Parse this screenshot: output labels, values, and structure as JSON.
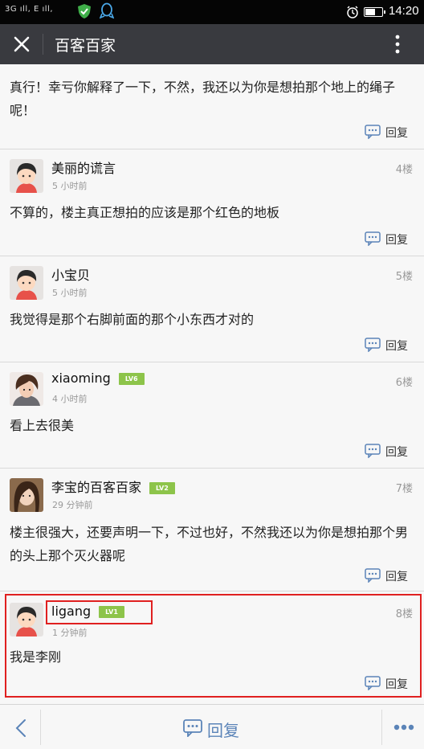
{
  "status_bar": {
    "signal_text": "3G ıll, E ıll,",
    "time": "14:20",
    "icons": [
      "shield-icon",
      "qq-icon",
      "alarm-icon",
      "battery-icon"
    ]
  },
  "title_bar": {
    "title": "百客百家",
    "close_icon": "close-icon",
    "more_icon": "more-vertical-icon"
  },
  "posts": [
    {
      "text": "真行！幸亏你解释了一下，不然，我还以为你是想拍那个地上的绳子呢！",
      "reply_label": "回复"
    },
    {
      "name": "美丽的谎言",
      "time": "5 小时前",
      "floor": "4楼",
      "text": "不算的，楼主真正想拍的应该是那个红色的地板",
      "reply_label": "回复"
    },
    {
      "name": "小宝贝",
      "time": "5 小时前",
      "floor": "5楼",
      "text": "我觉得是那个右脚前面的那个小东西才对的",
      "reply_label": "回复"
    },
    {
      "name": "xiaoming",
      "level": "LV6",
      "time": "4 小时前",
      "floor": "6楼",
      "text": "看上去很美",
      "reply_label": "回复"
    },
    {
      "name": "李宝的百客百家",
      "level": "LV2",
      "time": "29 分钟前",
      "floor": "7楼",
      "text": "楼主很强大，还要声明一下，不过也好，不然我还以为你是想拍那个男的头上那个灭火器呢",
      "reply_label": "回复"
    },
    {
      "name": "ligang",
      "level": "LV1",
      "time": "1 分钟前",
      "floor": "8楼",
      "text": "我是李刚",
      "reply_label": "回复"
    }
  ],
  "bottom_bar": {
    "reply_label": "回复",
    "back_icon": "chevron-left-icon",
    "more_icon": "more-horizontal-icon"
  },
  "colors": {
    "title_bar": "#393a3f",
    "level_badge": "#8dc44a",
    "accent_blue": "#5b84b8",
    "highlight_red": "#e02020"
  }
}
